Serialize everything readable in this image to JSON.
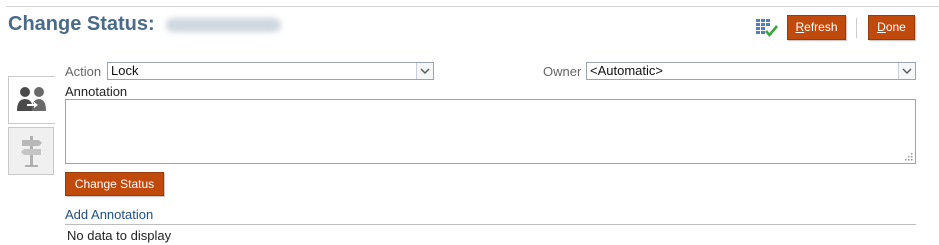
{
  "header": {
    "title": "Change Status:",
    "refresh_label_u": "R",
    "refresh_label_rest": "efresh",
    "done_label_u": "D",
    "done_label_rest": "one",
    "icon": "grid-check-icon"
  },
  "form": {
    "action_label": "Action",
    "action_value": "Lock",
    "owner_label": "Owner",
    "owner_value": "<Automatic>",
    "annotation_label": "Annotation",
    "annotation_value": "",
    "change_status_label": "Change Status"
  },
  "side_tabs": [
    {
      "icon": "users-transfer-icon",
      "active": true
    },
    {
      "icon": "signpost-icon",
      "active": false
    }
  ],
  "annotations": {
    "add_label": "Add Annotation",
    "empty_text": "No data to display"
  },
  "colors": {
    "accent": "#bf4a0c",
    "title": "#4a6a8a",
    "link": "#1f4f86"
  }
}
